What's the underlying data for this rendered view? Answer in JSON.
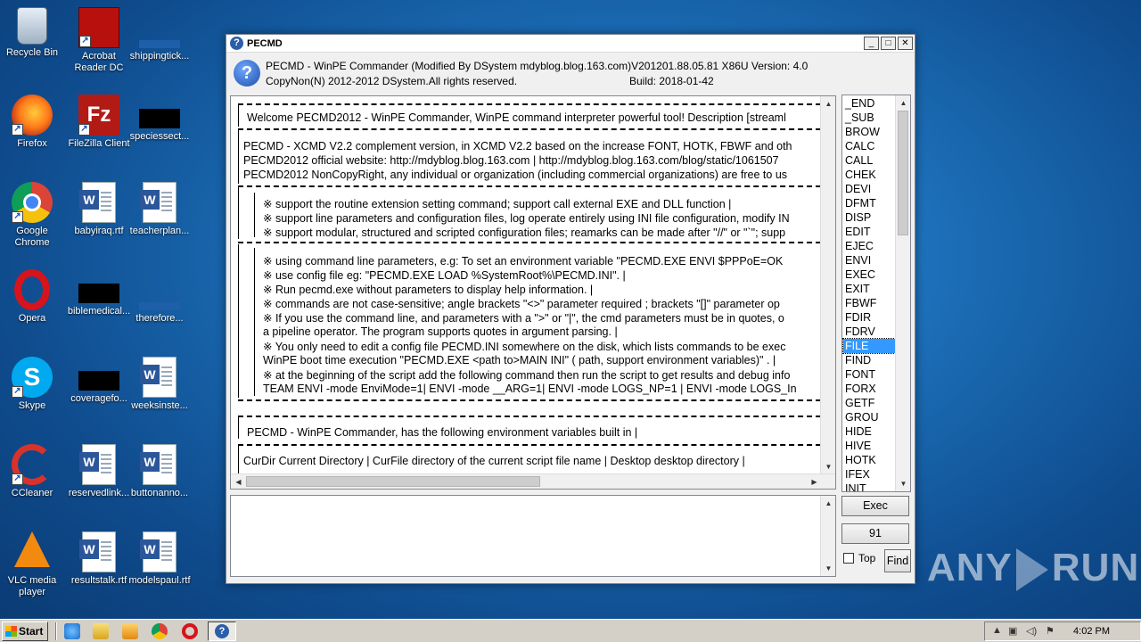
{
  "desktop": {
    "icons": [
      {
        "label": "Recycle Bin"
      },
      {
        "label": "Acrobat Reader DC"
      },
      {
        "label": "shippingtick..."
      },
      {
        "label": "Firefox"
      },
      {
        "label": "FileZilla Client"
      },
      {
        "label": "speciessect..."
      },
      {
        "label": "Google Chrome"
      },
      {
        "label": "babyiraq.rtf"
      },
      {
        "label": "teacherplan..."
      },
      {
        "label": "Opera"
      },
      {
        "label": "biblemedical..."
      },
      {
        "label": "therefore..."
      },
      {
        "label": "Skype"
      },
      {
        "label": "coveragefo..."
      },
      {
        "label": "weeksinste..."
      },
      {
        "label": "CCleaner"
      },
      {
        "label": "reservedlink..."
      },
      {
        "label": "buttonanno..."
      },
      {
        "label": "VLC media player"
      },
      {
        "label": "resultstalk.rtf"
      },
      {
        "label": "modelspaul.rtf"
      }
    ]
  },
  "window": {
    "title": "PECMD",
    "header_line1": "PECMD - WinPE Commander (Modified By DSystem mdyblog.blog.163.com)V201201.88.05.81 X86U  Version: 4.0",
    "header_line2": "CopyNon(N) 2012-2012 DSystem.All rights reserved.",
    "build": "Build: 2018-01-42",
    "text_lines": [
      "Welcome PECMD2012 - WinPE Commander, WinPE command interpreter powerful tool! Description [streaml",
      "PECMD - XCMD V2.2 complement version, in XCMD V2.2 based on the increase FONT, HOTK, FBWF and oth",
      "PECMD2012 official website: http://mdyblog.blog.163.com  |   http://mdyblog.blog.163.com/blog/static/1061507",
      "PECMD2012 NonCopyRight, any individual or organization (including commercial organizations) are free to us",
      "※  support the routine extension setting command; support call external EXE and DLL function  |",
      "※  support line parameters and configuration files, log operate entirely using INI file configuration, modify IN",
      "※  support modular, structured and scripted configuration files; reamarks can be made after \"//\" or \"`\"; supp",
      "※  using command line parameters, e.g: To set an environment variable  \"PECMD.EXE ENVI $PPPoE=OK",
      "※  use config file eg: \"PECMD.EXE LOAD %SystemRoot%\\PECMD.INI\".  |",
      "※  Run pecmd.exe without  parameters to display help information.  |",
      "※  commands are not case-sensitive; angle brackets \"<>\" parameter required ; brackets \"[]\" parameter op",
      "※  If you use the command line, and parameters with a \">\" or \"|\", the  cmd parameters  must be in quotes, o",
      "a pipeline operator. The program supports quotes in argument parsing.  |",
      "※  You only need to edit a config file PECMD.INI somewhere on the disk, which lists commands to be exec",
      "WinPE boot time execution \"PECMD.EXE <path to>MAIN INI\" ( path, support environment variables)\" .  |",
      "※  at the beginning of the script add the following command then run the script to get results and debug info",
      "TEAM ENVI -mode EnviMode=1| ENVI -mode __ARG=1| ENVI -mode LOGS_NP=1 | ENVI -mode LOGS_In",
      "PECMD - WinPE Commander, has the following environment variables built in |",
      "CurDir Current Directory  |  CurFile directory of the current script file name  |  Desktop desktop directory  |"
    ],
    "commands": [
      "_END",
      "_SUB",
      "BROW",
      "CALC",
      "CALL",
      "CHEK",
      "DEVI",
      "DFMT",
      "DISP",
      "EDIT",
      "EJEC",
      "ENVI",
      "EXEC",
      "EXIT",
      "FBWF",
      "FDIR",
      "FDRV",
      "FILE",
      "FIND",
      "FONT",
      "FORX",
      "GETF",
      "GROU",
      "HIDE",
      "HIVE",
      "HOTK",
      "IFEX",
      "INIT"
    ],
    "selected_command": "FILE",
    "exec_label": "Exec",
    "count_value": "91",
    "top_label": "Top",
    "find_label": "Find",
    "input_value": ""
  },
  "taskbar": {
    "start_label": "Start",
    "clock": "4:02 PM"
  },
  "watermark": {
    "left": "ANY",
    "right": "RUN"
  },
  "colors": {
    "selection": "#3399ff",
    "desktop": "#1c6fb8"
  }
}
